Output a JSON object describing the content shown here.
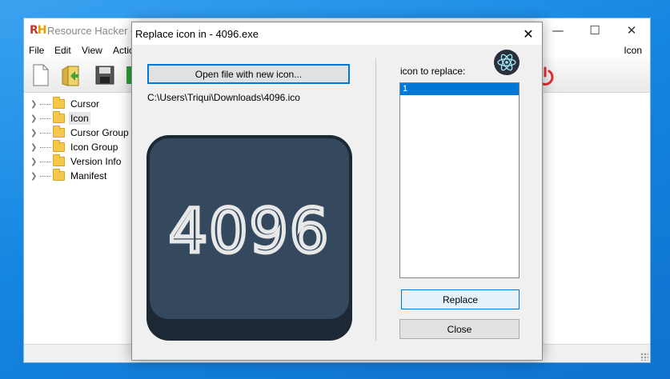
{
  "main_window": {
    "title": "Resource Hacker -",
    "app_icon_text_r": "R",
    "app_icon_text_h": "H",
    "menu": [
      "File",
      "Edit",
      "View",
      "Actio"
    ],
    "menu_right": "Icon",
    "tree": [
      {
        "label": "Cursor",
        "selected": false
      },
      {
        "label": "Icon",
        "selected": true
      },
      {
        "label": "Cursor Group",
        "selected": false
      },
      {
        "label": "Icon Group",
        "selected": false
      },
      {
        "label": "Version Info",
        "selected": false
      },
      {
        "label": "Manifest",
        "selected": false
      }
    ]
  },
  "dialog": {
    "title": "Replace icon in - 4096.exe",
    "open_button": "Open file with new icon...",
    "file_path": "C:\\Users\\Triqui\\Downloads\\4096.ico",
    "preview_text": "4096",
    "list_label": "icon to replace:",
    "list_items": [
      "1"
    ],
    "replace_button": "Replace",
    "close_button": "Close"
  },
  "colors": {
    "desktop": "#1485e0",
    "selection": "#0078d7",
    "preview_tile": "#34495e",
    "preview_tile_dark": "#1c2833"
  }
}
